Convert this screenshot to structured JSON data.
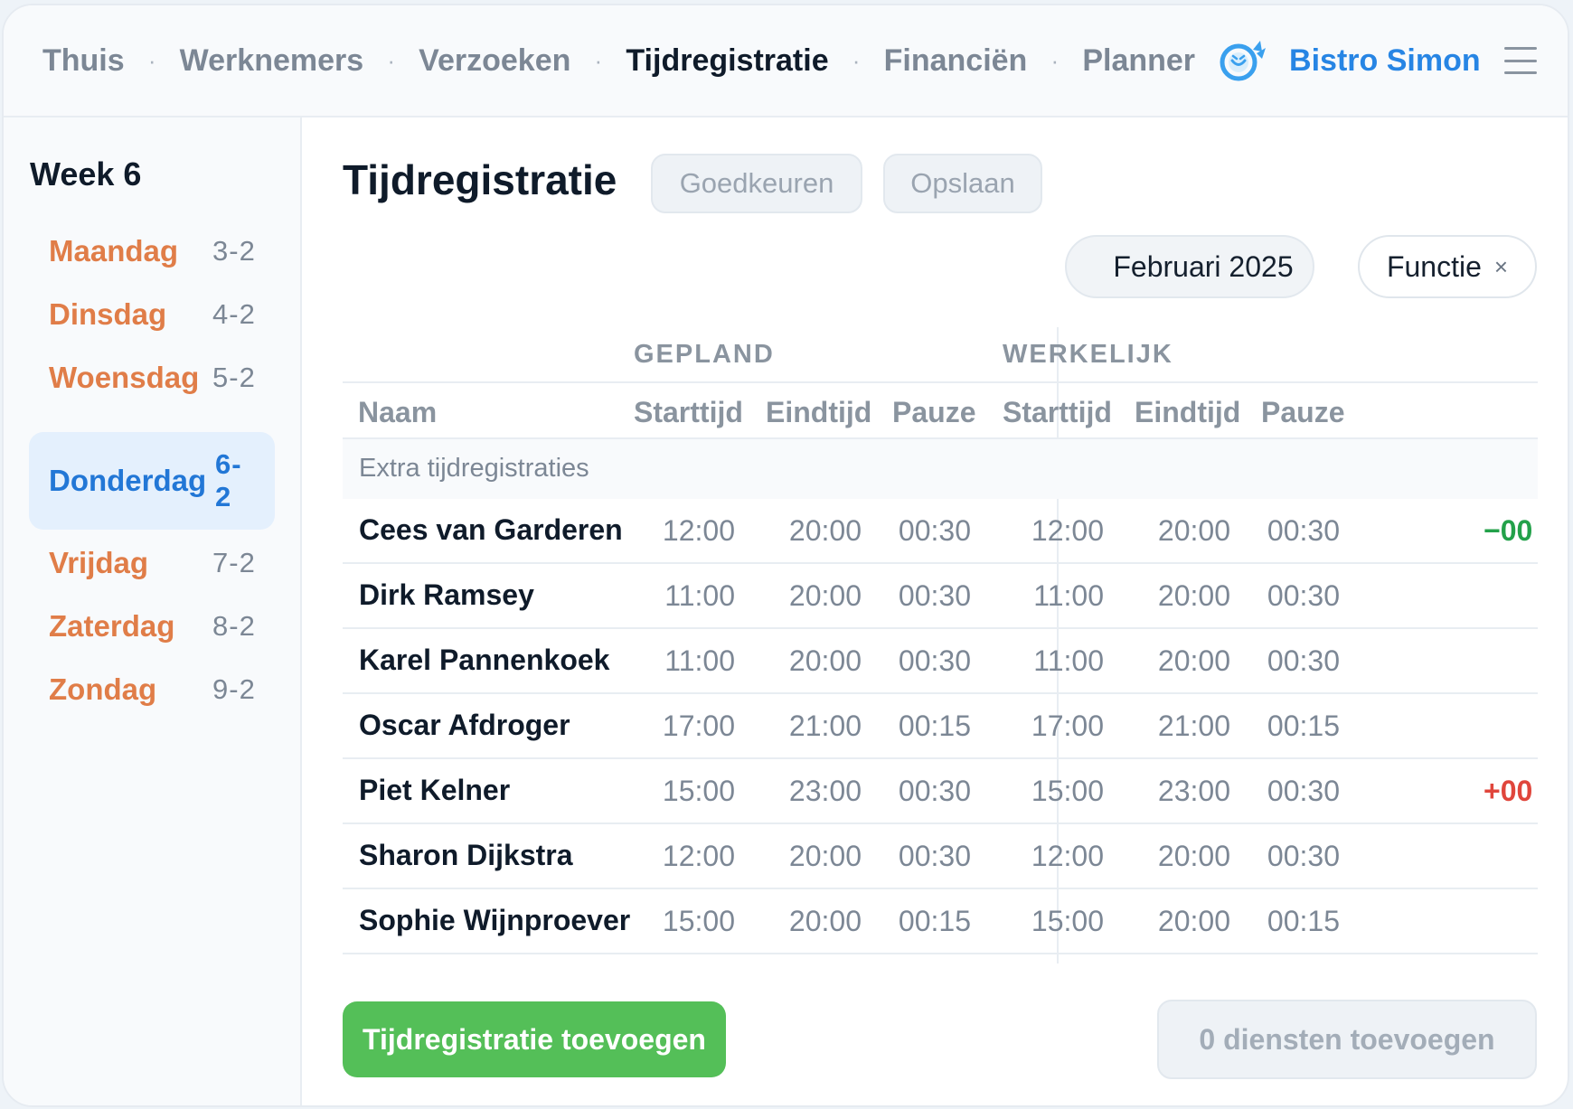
{
  "nav": {
    "items": [
      {
        "label": "Thuis",
        "active": false
      },
      {
        "label": "Werknemers",
        "active": false
      },
      {
        "label": "Verzoeken",
        "active": false
      },
      {
        "label": "Tijdregistratie",
        "active": true
      },
      {
        "label": "Financiën",
        "active": false
      },
      {
        "label": "Planner",
        "active": false
      }
    ],
    "separator": "·",
    "brand_name": "Bistro Simon",
    "brand_icon": "smile-bird-logo-icon",
    "menu_icon": "hamburger-menu-icon"
  },
  "sidebar": {
    "week_title": "Week 6",
    "days": [
      {
        "name": "Maandag",
        "date": "3-2",
        "active": false
      },
      {
        "name": "Dinsdag",
        "date": "4-2",
        "active": false
      },
      {
        "name": "Woensdag",
        "date": "5-2",
        "active": false
      },
      {
        "name": "Donderdag",
        "date": "6-2",
        "active": true
      },
      {
        "name": "Vrijdag",
        "date": "7-2",
        "active": false
      },
      {
        "name": "Zaterdag",
        "date": "8-2",
        "active": false
      },
      {
        "name": "Zondag",
        "date": "9-2",
        "active": false
      }
    ]
  },
  "main": {
    "title": "Tijdregistratie",
    "approve_label": "Goedkeuren",
    "save_label": "Opslaan",
    "month_filter": "Februari 2025",
    "function_filter": "Functie",
    "function_filter_clear": "×"
  },
  "table": {
    "group_planned": "GEPLAND",
    "group_actual": "WERKELIJK",
    "columns": {
      "name": "Naam",
      "planned_start": "Starttijd",
      "planned_end": "Eindtijd",
      "planned_break": "Pauze",
      "actual_start": "Starttijd",
      "actual_end": "Eindtijd",
      "actual_break": "Pauze"
    },
    "section_label": "Extra tijdregistraties",
    "rows": [
      {
        "name": "Cees van Garderen",
        "p_start": "12:00",
        "p_end": "20:00",
        "p_break": "00:30",
        "a_start": "12:00",
        "a_end": "20:00",
        "a_break": "00:30",
        "diff": "−00"
      },
      {
        "name": "Dirk Ramsey",
        "p_start": "11:00",
        "p_end": "20:00",
        "p_break": "00:30",
        "a_start": "11:00",
        "a_end": "20:00",
        "a_break": "00:30",
        "diff": ""
      },
      {
        "name": "Karel Pannenkoek",
        "p_start": "11:00",
        "p_end": "20:00",
        "p_break": "00:30",
        "a_start": "11:00",
        "a_end": "20:00",
        "a_break": "00:30",
        "diff": ""
      },
      {
        "name": "Oscar Afdroger",
        "p_start": "17:00",
        "p_end": "21:00",
        "p_break": "00:15",
        "a_start": "17:00",
        "a_end": "21:00",
        "a_break": "00:15",
        "diff": ""
      },
      {
        "name": "Piet Kelner",
        "p_start": "15:00",
        "p_end": "23:00",
        "p_break": "00:30",
        "a_start": "15:00",
        "a_end": "23:00",
        "a_break": "00:30",
        "diff": "+00"
      },
      {
        "name": "Sharon Dijkstra",
        "p_start": "12:00",
        "p_end": "20:00",
        "p_break": "00:30",
        "a_start": "12:00",
        "a_end": "20:00",
        "a_break": "00:30",
        "diff": ""
      },
      {
        "name": "Sophie Wijnproever",
        "p_start": "15:00",
        "p_end": "20:00",
        "p_break": "00:15",
        "a_start": "15:00",
        "a_end": "20:00",
        "a_break": "00:15",
        "diff": ""
      }
    ]
  },
  "footer": {
    "add_label": "Tijdregistratie toevoegen",
    "diensten_label": "0 diensten toevoegen"
  },
  "colors": {
    "accent_blue": "#2785e4",
    "day_orange": "#e07d48",
    "add_green": "#54bf58",
    "diff_negative": "#23a14a",
    "diff_positive": "#e0463c"
  }
}
